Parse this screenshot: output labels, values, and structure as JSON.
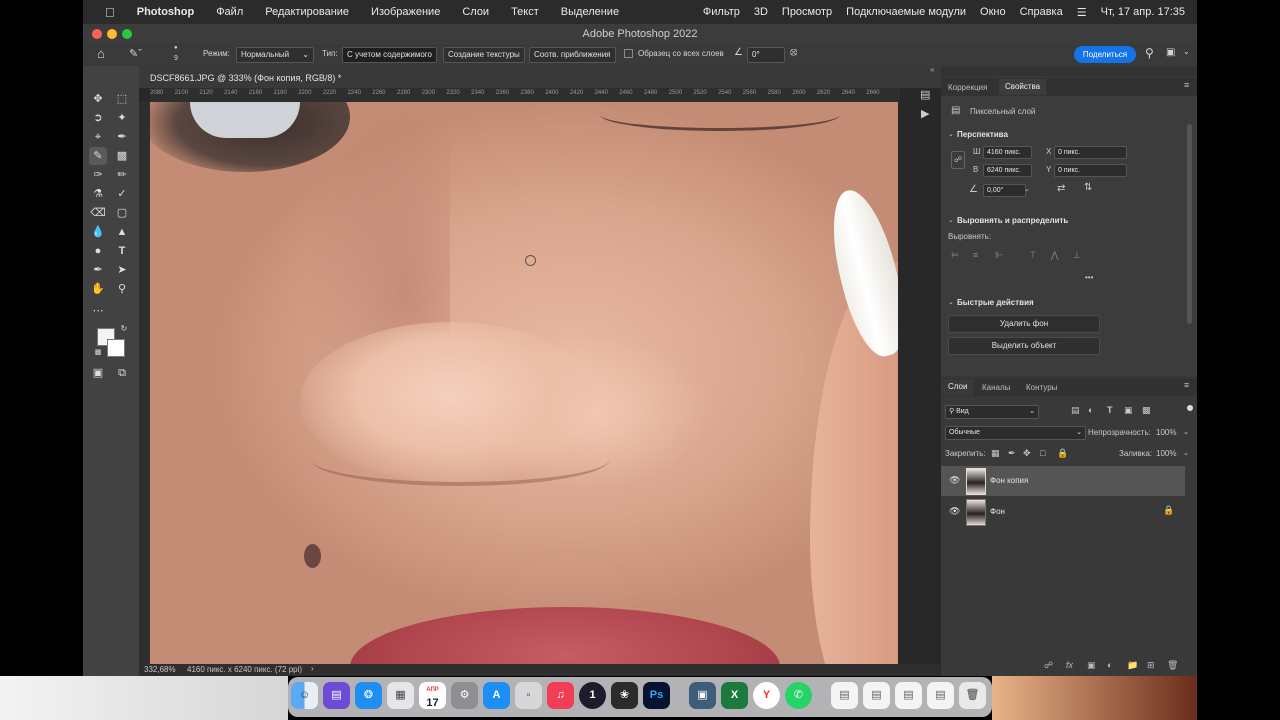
{
  "menubar": {
    "apple_icon": "apple-logo-icon",
    "app_name": "Photoshop",
    "items": [
      "Файл",
      "Редактирование",
      "Изображение",
      "Слои",
      "Текст",
      "Выделение",
      "Фильтр",
      "3D",
      "Просмотр",
      "Подключаемые модули",
      "Окно",
      "Справка"
    ],
    "datetime": "Чт, 17 апр.  17:35"
  },
  "window": {
    "title": "Adobe Photoshop 2022",
    "share_button": "Поделиться"
  },
  "options": {
    "brush_size": "9",
    "mode_label": "Режим:",
    "mode_value": "Нормальный",
    "type_label": "Тип:",
    "type_content_aware": "С учетом содержимого",
    "type_texture": "Создание текстуры",
    "type_proximity": "Соотв. приближения",
    "sample_all_layers": "Образец со всех слоев",
    "angle_value": "0°"
  },
  "document": {
    "tab_title": "DSCF8661.JPG @ 333% (Фон копия, RGB/8) *",
    "ruler_ticks": [
      "2080",
      "2100",
      "2120",
      "2140",
      "2160",
      "2180",
      "2200",
      "2220",
      "2240",
      "2260",
      "2280",
      "2300",
      "2320",
      "2340",
      "2360",
      "2380",
      "2400",
      "2420",
      "2440",
      "2460",
      "2480",
      "2500",
      "2520",
      "2540",
      "2560",
      "2580",
      "2600",
      "2620",
      "2640",
      "2660"
    ],
    "zoom": "332,68%",
    "doc_info": "4160 пикс. x 6240 пикс. (72 ppi)"
  },
  "properties": {
    "tabs": [
      "Коррекция",
      "Свойства"
    ],
    "active_tab": "Свойства",
    "layer_kind": "Пиксельный слой",
    "perspective_title": "Перспектива",
    "w_label": "Ш",
    "w_value": "4160 пикс.",
    "h_label": "В",
    "h_value": "6240 пикс.",
    "x_label": "X",
    "x_value": "0 пикс.",
    "y_label": "Y",
    "y_value": "0 пикс.",
    "angle_value": "0,00°",
    "align_title": "Выровнять и распределить",
    "align_label": "Выровнять:",
    "more_dots": "•••",
    "quick_actions_title": "Быстрые действия",
    "remove_bg": "Удалить фон",
    "select_subject": "Выделить объект"
  },
  "layers": {
    "tabs": [
      "Слои",
      "Каналы",
      "Контуры"
    ],
    "active_tab": "Слои",
    "filter_value": "Вид",
    "blend_mode": "Обычные",
    "opacity_label": "Непрозрачность:",
    "opacity_value": "100%",
    "lock_label": "Закрепить:",
    "fill_label": "Заливка:",
    "fill_value": "100%",
    "items": [
      {
        "name": "Фон копия",
        "selected": true,
        "locked": false
      },
      {
        "name": "Фон",
        "selected": false,
        "locked": true
      }
    ]
  },
  "dock": {
    "calendar_month": "АПР",
    "calendar_day": "17",
    "ps_label": "Ps"
  },
  "colors": {
    "accent": "#1473e6",
    "panel": "#383838",
    "menubar": "#2b2b2b"
  }
}
